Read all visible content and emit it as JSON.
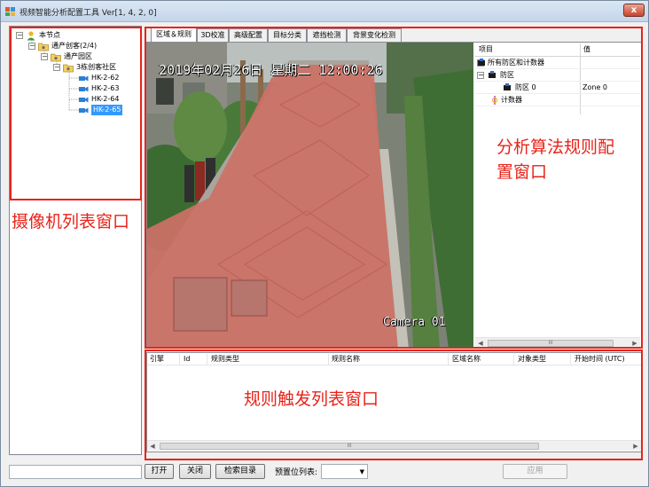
{
  "window": {
    "title": "视频智能分析配置工具 Ver[1, 4, 2, 0]",
    "close_glyph": "x"
  },
  "tree": {
    "nodes": [
      {
        "label": "本节点",
        "icon": "user-icon",
        "expander": "−"
      },
      {
        "label": "通产创客(2/4)",
        "icon": "folder-icon",
        "expander": "−"
      },
      {
        "label": "通产园区",
        "icon": "folder-icon",
        "expander": "−"
      },
      {
        "label": "3栋创客社区",
        "icon": "folder-icon",
        "expander": "−"
      },
      {
        "label": "HK-2-62",
        "icon": "camera-icon"
      },
      {
        "label": "HK-2-63",
        "icon": "camera-icon"
      },
      {
        "label": "HK-2-64",
        "icon": "camera-icon"
      },
      {
        "label": "HK-2-65",
        "icon": "camera-icon",
        "selected": true
      }
    ]
  },
  "tabs": [
    "区域＆规则",
    "3D校准",
    "高级配置",
    "目标分类",
    "遮挡检测",
    "背景变化检测"
  ],
  "video": {
    "osd_date": "2019年02月26日  星期二  12:00:26",
    "osd_camera": "Camera 01",
    "zone_color": "#d9534f"
  },
  "property_grid": {
    "header": {
      "item": "项目",
      "value": "值"
    },
    "rows": [
      {
        "label": "所有防区和计数器",
        "value": "",
        "expander": "−"
      },
      {
        "label": "防区",
        "value": "",
        "expander": "−"
      },
      {
        "label": "防区 0",
        "value": "Zone 0"
      },
      {
        "label": "计数器",
        "value": ""
      }
    ],
    "scroll_thumb": "III"
  },
  "rule_list": {
    "columns": [
      "引擎",
      "Id",
      "规则类型",
      "规则名称",
      "区域名称",
      "对象类型",
      "开始时间 (UTC)"
    ],
    "scroll_thumb": "III"
  },
  "annotations": {
    "camera_list": "摄像机列表窗口",
    "rule_config_line1": "分析算法规则配",
    "rule_config_line2": "置窗口",
    "trigger_list": "规则触发列表窗口",
    "color": "#e8231a"
  },
  "toolbar": {
    "open": "打开",
    "close": "关闭",
    "search_dir": "检索目录",
    "preset_label": "预置位列表:",
    "preset_value": "",
    "apply": "应用"
  }
}
